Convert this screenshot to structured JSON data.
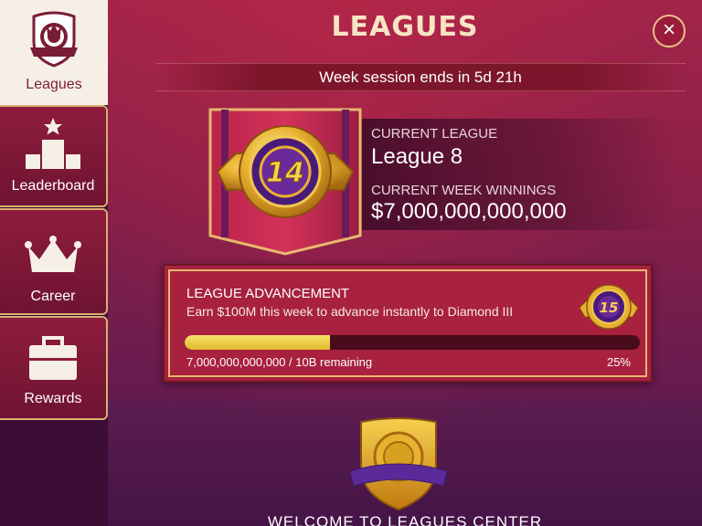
{
  "header": {
    "title": "LEAGUES",
    "close_icon": "close-icon",
    "close_label": "×",
    "session_text": "Week session ends in 5d 21h"
  },
  "sidebar": {
    "items": [
      {
        "label": "Leagues",
        "icon": "shield-chip-icon",
        "active": true
      },
      {
        "label": "Leaderboard",
        "icon": "podium-icon",
        "active": false
      },
      {
        "label": "Career",
        "icon": "crown-icon",
        "active": false
      },
      {
        "label": "Rewards",
        "icon": "briefcase-icon",
        "active": false
      }
    ]
  },
  "league": {
    "badge_number": "14",
    "current_league_label": "CURRENT LEAGUE",
    "current_league_value": "League 8",
    "winnings_label": "CURRENT WEEK WINNINGS",
    "winnings_value": "$7,000,000,000,000"
  },
  "advancement": {
    "title": "LEAGUE ADVANCEMENT",
    "description": "Earn $100M this week to advance instantly to Diamond III",
    "next_badge_number": "15",
    "remaining_text": "7,000,000,000,000 / 10B remaining",
    "percent_text": "25%",
    "progress_fraction": 0.32
  },
  "welcome": {
    "text": "WELCOME TO LEAGUES CENTER"
  },
  "colors": {
    "accent_gold": "#e7b76e",
    "progress_yellow": "#f0d44a",
    "card_red": "#a8213e",
    "chip_purple": "#4a1a7a"
  }
}
